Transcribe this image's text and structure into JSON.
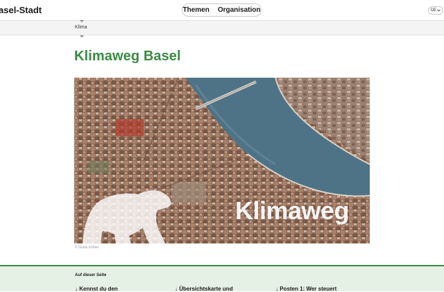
{
  "header": {
    "brand": "asel-Stadt",
    "nav": [
      "Themen",
      "Organisation"
    ],
    "language": "DE"
  },
  "breadcrumb": {
    "current": "Klima"
  },
  "main": {
    "title": "Klimaweg Basel",
    "hero_text": "Klimaweg",
    "photo_credit": "© Guido Köhler"
  },
  "toc": {
    "heading": "Auf dieser Seite",
    "links": [
      "↓ Kennst du den",
      "↓ Übersichtskarte und",
      "↓ Posten 1: Wer steuert"
    ]
  },
  "colors": {
    "accent_green": "#3a8a43",
    "toc_background": "#e6f1e5",
    "river": "#4e7386"
  }
}
